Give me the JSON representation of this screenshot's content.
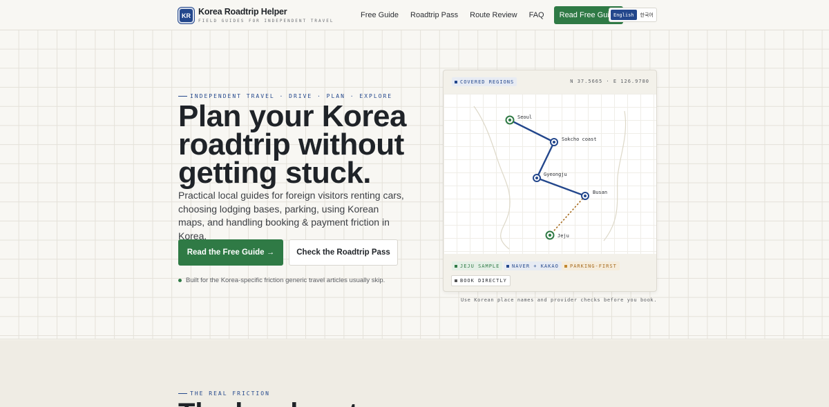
{
  "header": {
    "badge": "KR",
    "title": "Korea Roadtrip Helper",
    "subtitle": "FIELD GUIDES FOR INDEPENDENT TRAVEL",
    "nav": [
      "Free Guide",
      "Roadtrip Pass",
      "Route Review",
      "FAQ"
    ],
    "cta": "Read Free Guide",
    "lang_en": "English",
    "lang_ko": "한국어"
  },
  "hero": {
    "eyebrow": "INDEPENDENT TRAVEL · DRIVE · PLAN · EXPLORE",
    "title_line1": "Plan your Korea",
    "title_line2": "roadtrip without",
    "title_line3": "getting stuck.",
    "description": "Practical local guides for foreign visitors renting cars, choosing lodging bases, parking, using Korean maps, and handling booking & payment friction in Korea.",
    "primary_button": "Read the Free Guide →",
    "secondary_button": "Check the Roadtrip Pass",
    "note": "Built for the Korea-specific friction generic travel articles usually skip."
  },
  "map_card": {
    "header_chip": "COVERED REGIONS",
    "coords": "N 37.5665 · E 126.9780",
    "cities": [
      "Seoul",
      "Sokcho coast",
      "Gyeongju",
      "Busan",
      "Jeju"
    ],
    "tags": [
      "JEJU SAMPLE",
      "NAVER + KAKAO",
      "PARKING-FIRST",
      "BOOK DIRECTLY"
    ],
    "caption": "Use Korean place names and provider checks before you book.",
    "colors": {
      "route": "#23478c",
      "ferry": "#a66a1c",
      "node_green": "#2f7a45"
    }
  },
  "section2": {
    "eyebrow": "THE REAL FRICTION",
    "title_partial": "The local part"
  },
  "colors": {
    "accent_green": "#2f7a45",
    "brand_blue": "#23478c",
    "background": "#f8f7f3"
  }
}
